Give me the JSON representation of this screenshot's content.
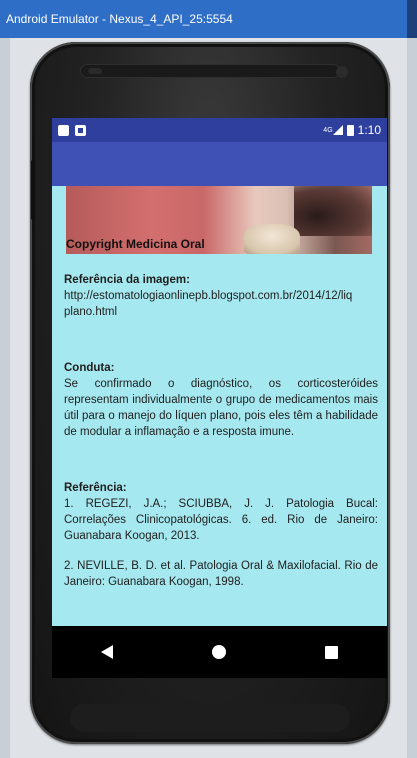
{
  "window": {
    "title": "Android Emulator - Nexus_4_API_25:5554"
  },
  "status_bar": {
    "time": "1:10",
    "network": "4G"
  },
  "image": {
    "caption": "Copyright Medicina Oral"
  },
  "image_reference": {
    "heading": "Referência da imagem:",
    "url_line1": "http://estomatologiaonlinepb.blogspot.com.br/2014/12/liq",
    "url_line2": "plano.html"
  },
  "conduta": {
    "heading": "Conduta:",
    "text": "Se confirmado o diagnóstico, os corticosteróides representam individualmente o grupo de medicamentos mais útil para o manejo do líquen plano, pois eles têm a habilidade de modular a inflamação e a resposta imune."
  },
  "referencias": {
    "heading": "Referência:",
    "items": [
      "1. REGEZI, J.A.; SCIUBBA, J. J. Patologia Bucal: Correlações Clinicopatológicas. 6. ed. Rio de Janeiro: Guanabara Koogan, 2013.",
      "2. NEVILLE, B. D. et al. Patologia Oral & Maxilofacial. Rio de Janeiro: Guanabara Koogan, 1998."
    ]
  }
}
